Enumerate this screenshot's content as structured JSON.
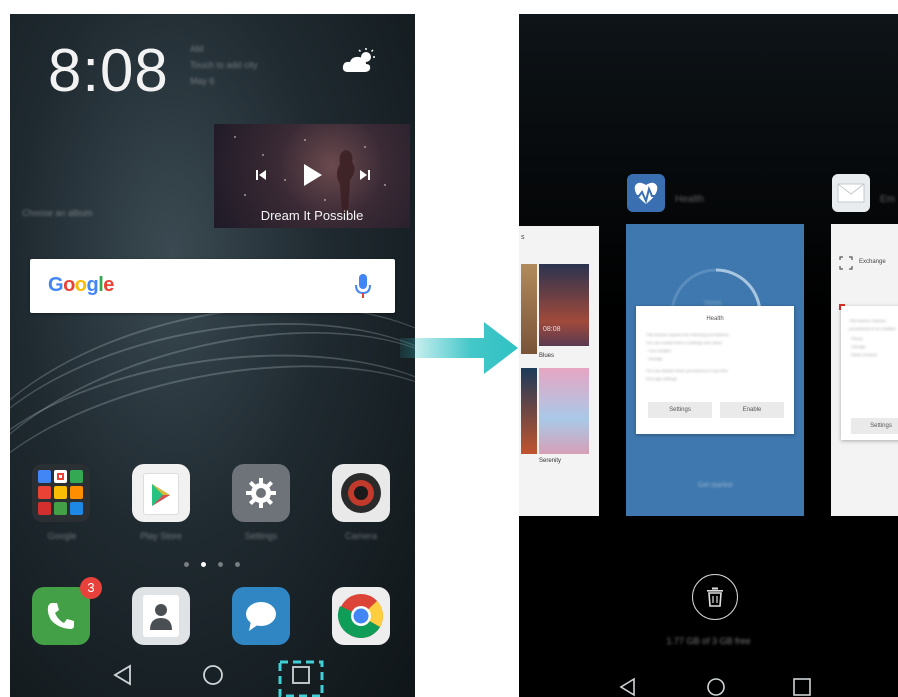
{
  "left_screen": {
    "clock": "8:08",
    "weather_lines": [
      "AM",
      "Touch to add city",
      "May 6"
    ],
    "music": {
      "title": "Dream It Possible",
      "album_hint": "Choose an album"
    },
    "search": {
      "logo": "Google"
    },
    "apps": [
      {
        "label": "Google",
        "icon": "google-folder-icon"
      },
      {
        "label": "Play Store",
        "icon": "play-store-icon"
      },
      {
        "label": "Settings",
        "icon": "settings-gear-icon"
      },
      {
        "label": "Camera",
        "icon": "camera-icon"
      }
    ],
    "dock": [
      {
        "icon": "phone-icon",
        "badge": "3"
      },
      {
        "icon": "contacts-icon"
      },
      {
        "icon": "messages-icon"
      },
      {
        "icon": "chrome-icon"
      }
    ],
    "page_count": 4,
    "active_page": 1
  },
  "right_screen": {
    "cards": [
      {
        "name": "Themes",
        "header_fragment": "s",
        "themes": [
          "Blues",
          "Serenity"
        ],
        "time_preview": "08:08"
      },
      {
        "name": "Health",
        "dialog_title": "Health",
        "dialog_lines": [
          "This feature requires the following permissions.",
          "You can enable them in settings and check",
          "· Your location",
          "· Storage",
          "You can disable these permissions in any time",
          "from app settings."
        ],
        "buttons": [
          "Settings",
          "Enable"
        ],
        "footer": "Get started",
        "ring_label": "Steps"
      },
      {
        "name": "Email",
        "header_fragment": "Em",
        "account": "Exchange",
        "dialog_lines": [
          "This feature requires",
          "permissions to be enabled",
          "· Phone",
          "· Storage",
          "· Read contacts"
        ],
        "button": "Settings"
      }
    ],
    "memory": "1.77 GB of 3 GB free"
  },
  "colors": {
    "arrow": "#2fc1c3",
    "health_card": "#3e78ae",
    "badge": "#e8403a",
    "highlight": "#3fd0d8"
  }
}
